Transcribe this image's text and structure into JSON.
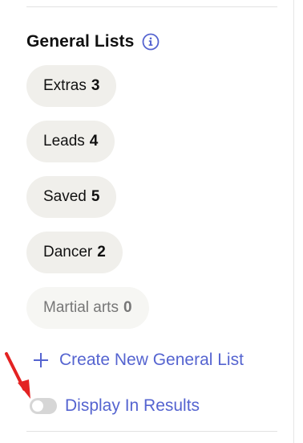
{
  "section": {
    "title": "General Lists",
    "info_icon": "info-icon"
  },
  "lists": [
    {
      "name": "Extras",
      "count": "3"
    },
    {
      "name": "Leads",
      "count": "4"
    },
    {
      "name": "Saved",
      "count": "5"
    },
    {
      "name": "Dancer",
      "count": "2"
    },
    {
      "name": "Martial arts",
      "count": "0"
    }
  ],
  "create": {
    "icon": "plus-icon",
    "label": "Create New General List"
  },
  "display_toggle": {
    "label": "Display In Results",
    "on": false
  },
  "annotation": {
    "icon": "red-arrow-icon"
  },
  "colors": {
    "accent": "#5564d0",
    "chip_bg": "#f0efeb",
    "arrow": "#e32222"
  }
}
